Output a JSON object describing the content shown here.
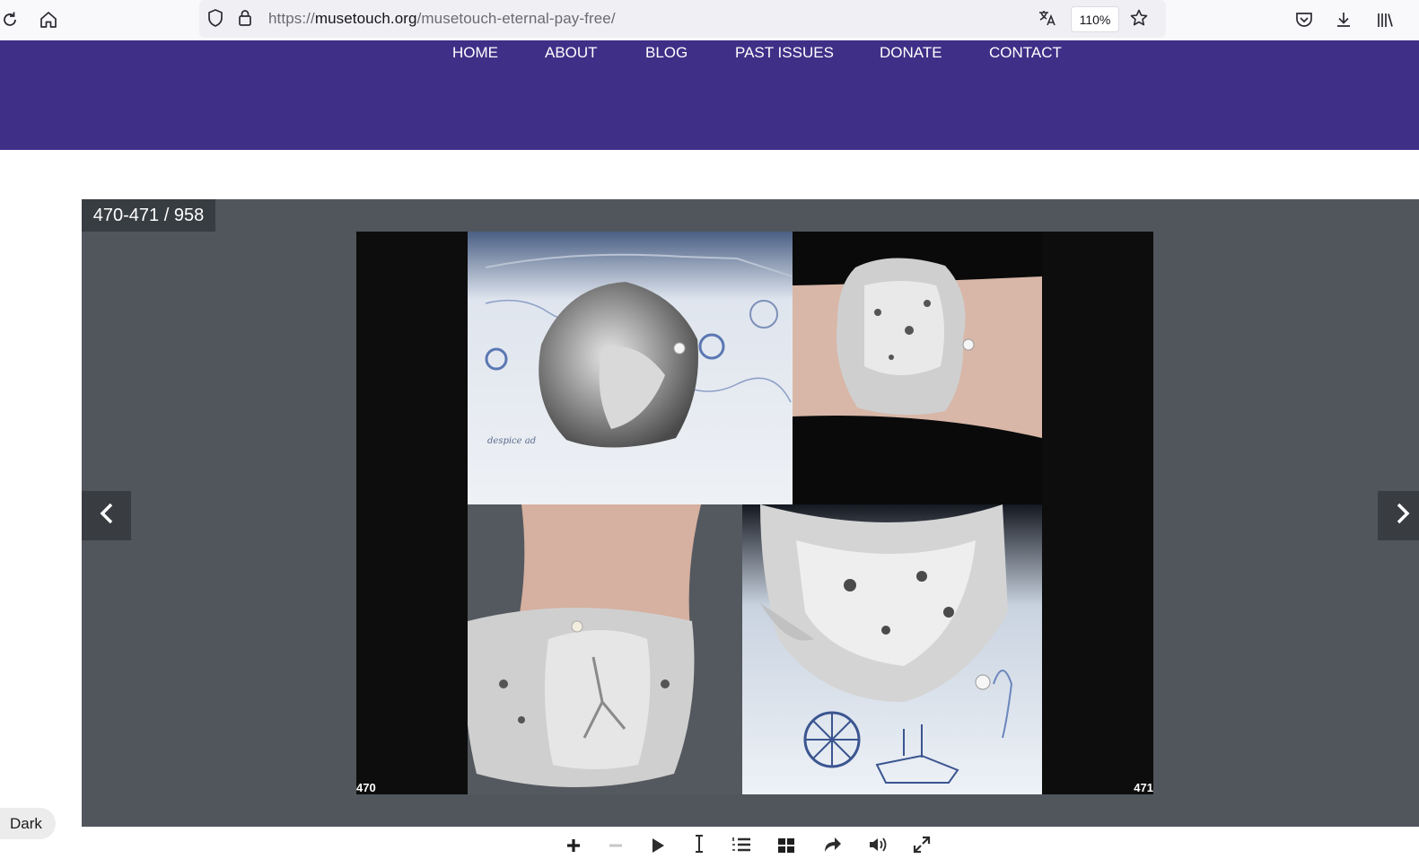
{
  "browser": {
    "url_prefix": "https://",
    "url_domain": "musetouch.org",
    "url_path": "/musetouch-eternal-pay-free/",
    "zoom": "110%"
  },
  "site": {
    "nav": [
      "HOME",
      "ABOUT",
      "BLOG",
      "PAST ISSUES",
      "DONATE",
      "CONTACT"
    ],
    "header_color": "#3f2f87"
  },
  "viewer": {
    "page_counter": "470-471 / 958",
    "left_page_number": "470",
    "right_page_number": "471",
    "background": "#50565c",
    "photos": [
      "silver-cuff-bracelet-on-map",
      "silver-cuff-bracelet-on-wrist",
      "wide-silver-bracelet-on-wrist",
      "silver-cuff-bracelet-closeup"
    ]
  },
  "toolbar": {
    "icons": [
      "zoom-in-icon",
      "zoom-out-icon",
      "play-icon",
      "text-select-icon",
      "table-of-contents-icon",
      "thumbnails-icon",
      "share-icon",
      "sound-icon",
      "fullscreen-icon"
    ]
  },
  "theme_toggle": {
    "label": "Dark"
  }
}
